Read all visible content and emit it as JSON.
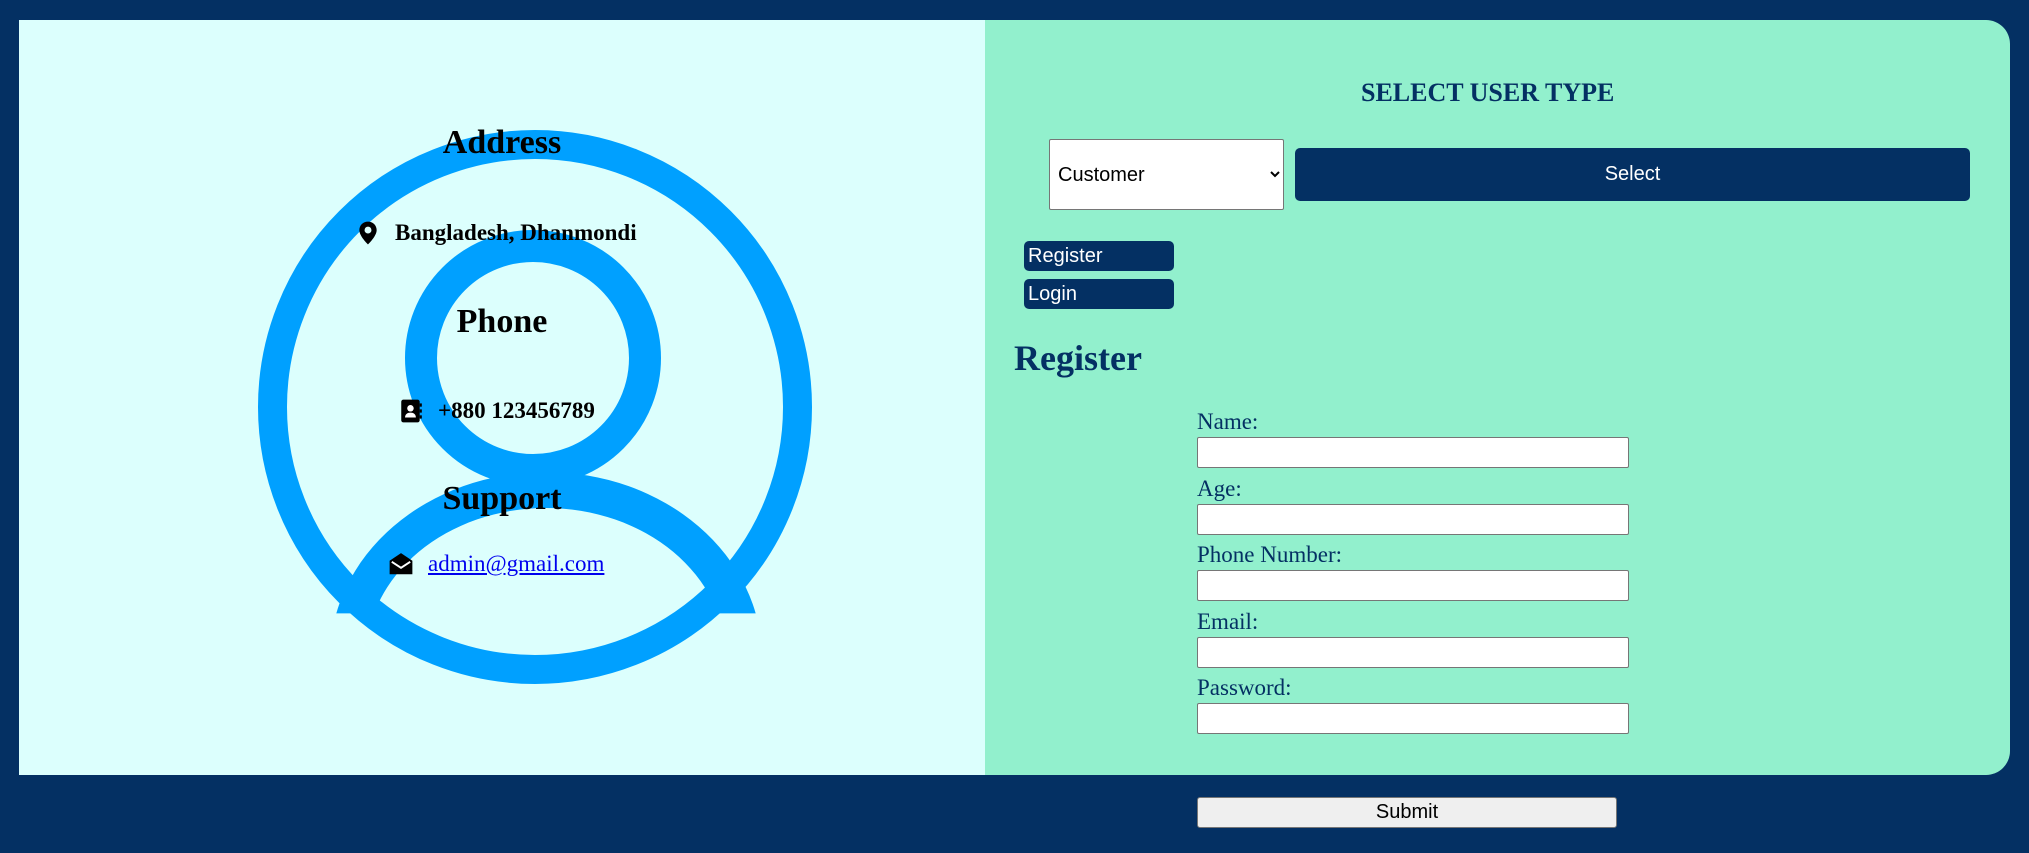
{
  "contact": {
    "address": {
      "title": "Address",
      "text": "Bangladesh, Dhanmondi",
      "icon": "map-pin-icon"
    },
    "phone": {
      "title": "Phone",
      "text": "+880 123456789",
      "icon": "contact-book-icon"
    },
    "support": {
      "title": "Support",
      "email": "admin@gmail.com",
      "icon": "envelope-open-icon"
    }
  },
  "user_type": {
    "title": "SELECT USER TYPE",
    "selected": "Customer",
    "button": "Select"
  },
  "tabs": {
    "register": "Register",
    "login": "Login"
  },
  "form": {
    "heading": "Register",
    "fields": {
      "name": "Name:",
      "age": "Age:",
      "phone": "Phone Number:",
      "email": "Email:",
      "password": "Password:"
    },
    "submit": "Submit"
  },
  "colors": {
    "background": "#043063",
    "left_panel": "#dcfffd",
    "right_panel": "#92f0cd",
    "accent_blue": "#00a0ff"
  }
}
